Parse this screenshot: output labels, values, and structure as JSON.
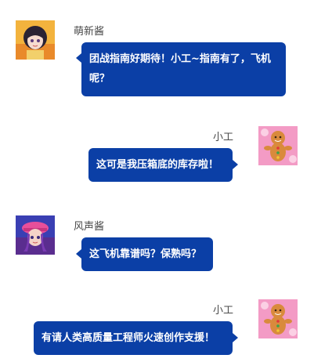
{
  "messages": [
    {
      "sender": "萌新酱",
      "side": "left",
      "avatar": "anime-girl-avatar",
      "text": "团战指南好期待！小工~指南有了，飞机呢？"
    },
    {
      "sender": "小工",
      "side": "right",
      "avatar": "gingerbread-avatar",
      "text": "这可是我压箱底的库存啦！"
    },
    {
      "sender": "风声酱",
      "side": "left",
      "avatar": "pink-hat-girl-avatar",
      "text": "这飞机靠谱吗？保熟吗？"
    },
    {
      "sender": "小工",
      "side": "right",
      "avatar": "gingerbread-avatar",
      "text": "有请人类高质量工程师火速创作支援！"
    }
  ],
  "colors": {
    "bubble": "#0b3fa6",
    "bubble_text": "#ffffff",
    "name_text": "#4a4a4a"
  }
}
